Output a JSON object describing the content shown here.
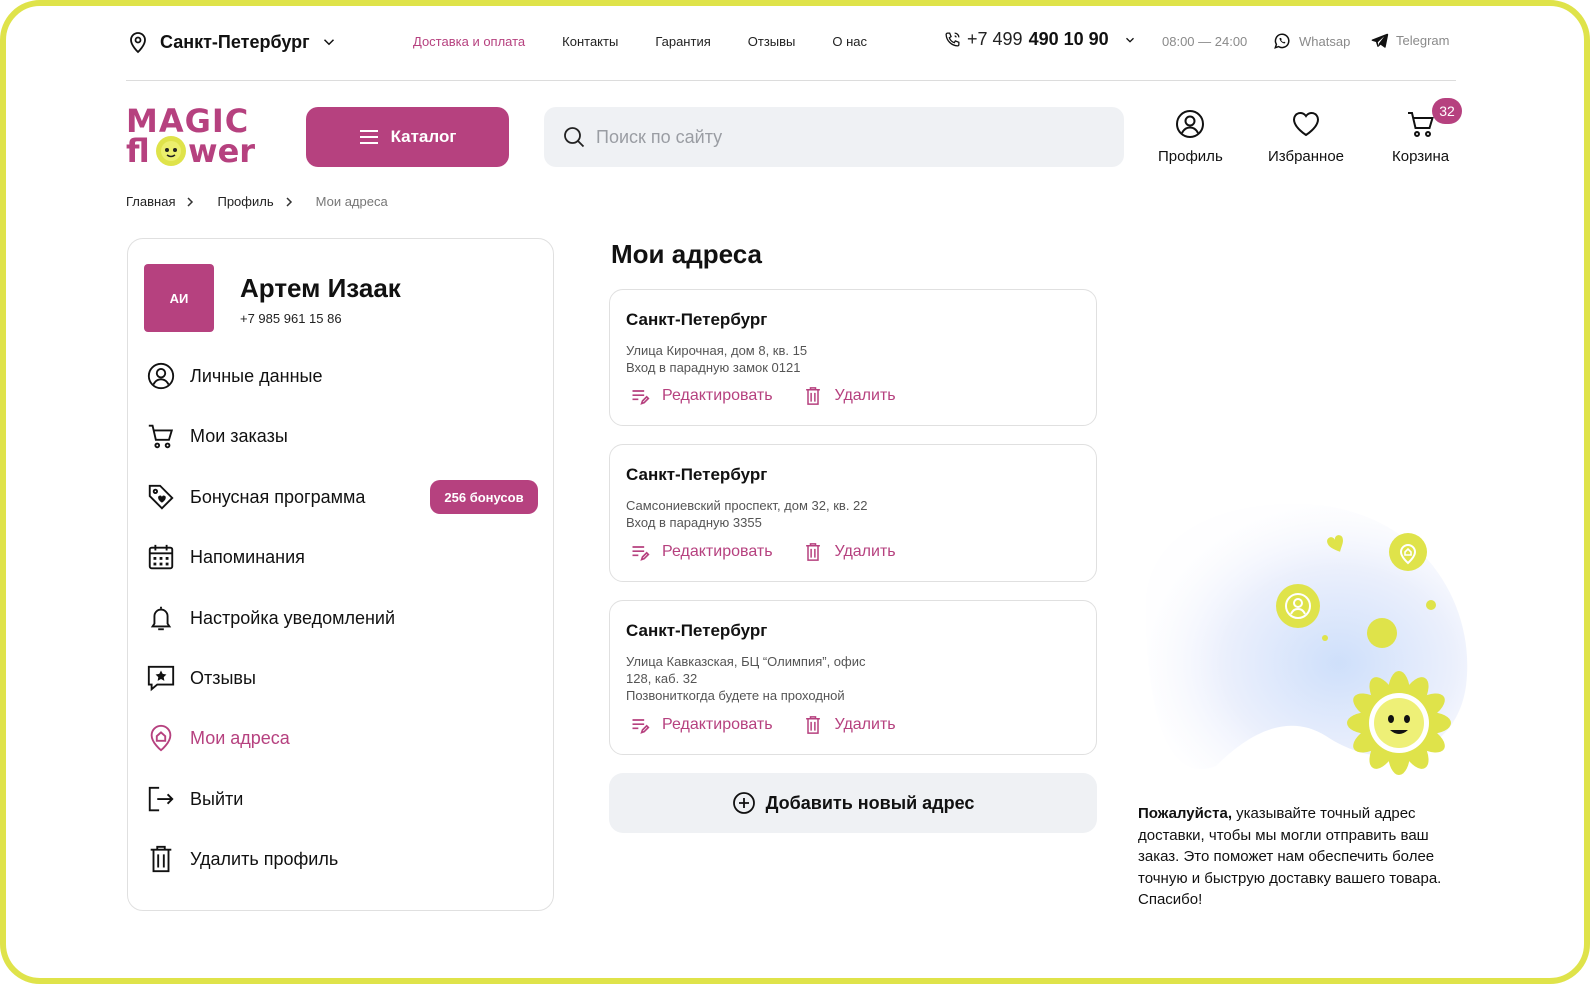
{
  "topbar": {
    "city": "Санкт-Петербург",
    "links": [
      {
        "label": "Доставка и оплата",
        "active": true
      },
      {
        "label": "Контакты",
        "active": false
      },
      {
        "label": "Гарантия",
        "active": false
      },
      {
        "label": "Отзывы",
        "active": false
      },
      {
        "label": "О нас",
        "active": false
      }
    ],
    "phone_prefix": "+7 499",
    "phone_main": "490 10 90",
    "hours": "08:00 — 24:00",
    "whatsapp": "Whatsap",
    "telegram": "Telegram"
  },
  "header": {
    "logo_line1": "MAGIC",
    "logo_line2": "flower",
    "catalog_label": "Каталог",
    "search_placeholder": "Поиск по сайту",
    "profile_label": "Профиль",
    "favorites_label": "Избранное",
    "cart_label": "Корзина",
    "cart_count": "32"
  },
  "breadcrumb": {
    "home": "Главная",
    "profile": "Профиль",
    "current": "Мои адреса"
  },
  "sidebar": {
    "avatar_initials": "АИ",
    "user_name": "Артем Изаак",
    "user_phone": "+7 985 961 15 86",
    "bonus_badge": "256 бонусов",
    "items": [
      {
        "label": "Личные данные"
      },
      {
        "label": "Мои заказы"
      },
      {
        "label": "Бонусная программа"
      },
      {
        "label": "Напоминания"
      },
      {
        "label": "Настройка уведомлений"
      },
      {
        "label": "Отзывы"
      },
      {
        "label": "Мои адреса"
      },
      {
        "label": "Выйти"
      },
      {
        "label": "Удалить профиль"
      }
    ]
  },
  "main": {
    "title": "Мои адреса",
    "addresses": [
      {
        "city": "Санкт-Петербург",
        "line1": "Улица Кирочная, дом 8, кв. 15",
        "line2": "Вход в парадную замок 0121"
      },
      {
        "city": "Санкт-Петербург",
        "line1": "Самсониевский проспект, дом 32, кв. 22",
        "line2": "Вход в парадную 3355"
      },
      {
        "city": "Санкт-Петербург",
        "line1": "Улица Кавказская, БЦ “Олимпия”, офис 128, каб. 32",
        "line2": "Позвониткогда будете на проходной"
      }
    ],
    "edit_label": "Редактировать",
    "delete_label": "Удалить",
    "add_label": "Добавить новый адрес"
  },
  "note": {
    "bold": "Пожалуйста,",
    "text": " указывайте точный адрес доставки, чтобы мы могли отправить ваш заказ. Это поможет нам обеспечить более точную и быструю доставку вашего товара. Спасибо!"
  },
  "colors": {
    "accent": "#b6417f",
    "frame": "#dfe34a",
    "field_bg": "#eff1f4",
    "illustration_yellow": "#dfe34a"
  }
}
